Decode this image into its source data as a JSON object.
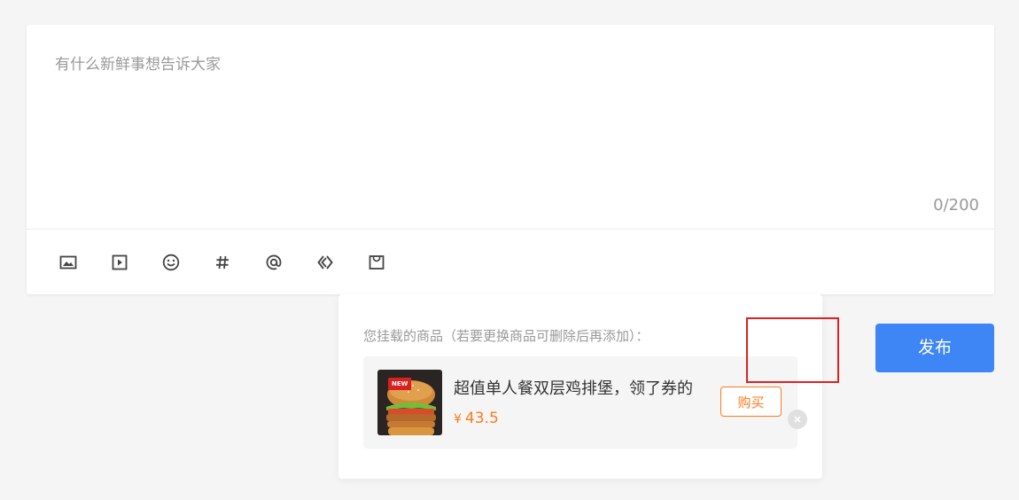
{
  "composer": {
    "placeholder": "有什么新鲜事想告诉大家",
    "value": "",
    "counter": "0/200"
  },
  "toolbar": {
    "items": [
      {
        "icon": "image-icon"
      },
      {
        "icon": "video-icon"
      },
      {
        "icon": "emoji-icon"
      },
      {
        "icon": "hashtag-icon"
      },
      {
        "icon": "mention-icon"
      },
      {
        "icon": "code-icon"
      },
      {
        "icon": "shopping-bag-icon"
      }
    ]
  },
  "product_popup": {
    "title": "您挂载的商品（若要更换商品可删除后再添加）：",
    "product": {
      "name": "超值单人餐双层鸡排堡，领了券的",
      "currency": "¥",
      "price": "43.5",
      "badge": "NEW",
      "buy_label": "购买"
    }
  },
  "publish_label": "发布",
  "colors": {
    "accent": "#3e86f5",
    "price": "#ff7a1a",
    "highlight": "#e02020"
  }
}
